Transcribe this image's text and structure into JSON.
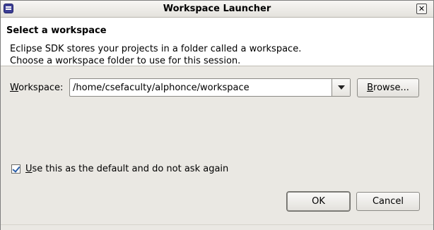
{
  "window": {
    "title": "Workspace Launcher",
    "close_glyph": "✕"
  },
  "header": {
    "title": "Select a workspace",
    "desc_line1": "Eclipse SDK stores your projects in a folder called a workspace.",
    "desc_line2": "Choose a workspace folder to use for this session."
  },
  "workspace": {
    "label_mnemonic": "W",
    "label_rest": "orkspace:",
    "value": "/home/csefaculty/alphonce/workspace"
  },
  "browse": {
    "mnemonic": "B",
    "rest": "rowse..."
  },
  "default_checkbox": {
    "checked": true,
    "mnemonic": "U",
    "rest": "se this as the default and do not ask again"
  },
  "buttons": {
    "ok": "OK",
    "cancel": "Cancel"
  },
  "colors": {
    "header_bg": "#ffffff",
    "dialog_bg": "#eae8e3",
    "app_icon": "#3d3f95"
  },
  "icons": {
    "app": "eclipse-app-icon",
    "close": "close-icon",
    "dropdown": "chevron-down-icon"
  }
}
